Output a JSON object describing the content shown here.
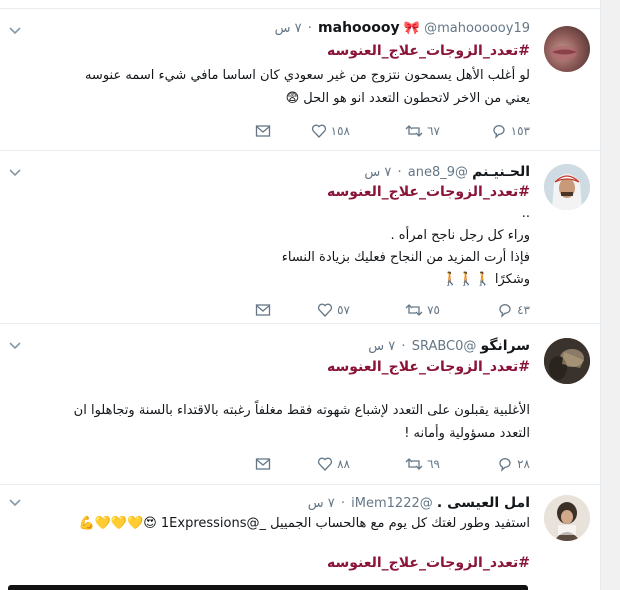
{
  "top_strip": {
    "reply_count": "",
    "retweet_count": ""
  },
  "tweets": [
    {
      "name": "mahooooy",
      "handle": "@mahoooooy19",
      "time": "٧ س",
      "hashtag": "#تعدد_الزوجات_علاج_العنوسه",
      "lines": [
        "لو أغلب الأهل يسمحون نتزوج من غير سعودي كان اساسا مافي شيء اسمه عنوسه",
        "يعني من الاخر لاتحطون التعدد انو هو الحل 😨"
      ],
      "replies": "١٥٣",
      "retweets": "٦٧",
      "likes": "١٥٨"
    },
    {
      "name": "الحـنيـنم",
      "handle": "@ane8_9",
      "time": "٧ س",
      "hashtag": "#تعدد_الزوجات_علاج_العنوسه",
      "lines": [
        "..",
        "وراء كل رجل ناجح امرأه .",
        "فإذا أرت المزيد من النجاح  فعليك بزيادة النساء",
        "وشكرًا 🚶🚶🚶"
      ],
      "replies": "٤٣",
      "retweets": "٧٥",
      "likes": "٥٧"
    },
    {
      "name": "سرانگو",
      "handle": "@SRABC0",
      "time": "٧ س",
      "hashtag": "#تعدد_الزوجات_علاج_العنوسه",
      "lines": [
        "الأغلبية يقبلون على التعدد لإشباع شهوته فقط مغلفاً رغبته بالاقتداء بالسنة وتجاهلوا ان",
        "التعدد مسؤولية وأمانه !"
      ],
      "replies": "٢٨",
      "retweets": "٦٩",
      "likes": "٨٨"
    },
    {
      "name": "امل العيسى .",
      "handle": "@iMem1222",
      "time": "٧ س",
      "hashtag": "#تعدد_الزوجات_علاج_العنوسه",
      "lines": [
        "استفيد وطور لغتك كل يوم مع هالحساب الجمييل _@1Expressions 😍💛💛💛💪"
      ],
      "replies": "",
      "retweets": "",
      "likes": ""
    }
  ],
  "icons": {
    "reply": "reply-icon",
    "retweet": "retweet-icon",
    "like": "heart-icon",
    "dm": "envelope-icon",
    "caret": "chevron-down-icon"
  },
  "colors": {
    "hashtag": "#8a1538",
    "muted": "#657786",
    "border": "#e6ecf0"
  }
}
